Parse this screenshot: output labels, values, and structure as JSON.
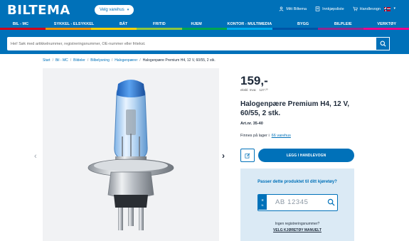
{
  "header": {
    "logo": "BILTEMA",
    "store_button": "Velg varehus",
    "links": [
      {
        "label": "Mitt Biltema",
        "icon": "user-icon"
      },
      {
        "label": "Innkjøpsliste",
        "icon": "list-icon"
      },
      {
        "label": "Handlevogn",
        "icon": "cart-icon"
      }
    ],
    "flag_icon": "norway-flag-icon"
  },
  "nav": {
    "items": [
      {
        "label": "BIL - MC",
        "color": "#d0021b"
      },
      {
        "label": "SYKKEL - ELSYKKEL",
        "color": "#f39200"
      },
      {
        "label": "BÅT",
        "color": "#ffd200"
      },
      {
        "label": "FRITID",
        "color": "#8cc63f"
      },
      {
        "label": "HJEM",
        "color": "#00a651"
      },
      {
        "label": "KONTOR - MULTIMEDIA",
        "color": "#00aeef"
      },
      {
        "label": "BYGG",
        "color": "#0054a6"
      },
      {
        "label": "BILPLEIE",
        "color": "#92278f"
      },
      {
        "label": "VERKTØY",
        "color": "#ec008c"
      }
    ]
  },
  "search": {
    "placeholder": "Hei! Søk med artikkelnummer, registreringsnummer, OE-nummer eller fritekst."
  },
  "breadcrumb": {
    "items": [
      "Start",
      "Bil - MC",
      "Bildeler",
      "Bilbelysning",
      "Halogenpærer"
    ],
    "current": "Halogenpære Premium H4, 12 V, 60/55, 2 stk."
  },
  "product": {
    "price": "159,-",
    "price_ex_label": "ekskl. mva:",
    "price_ex_value": "127.²⁰",
    "title": "Halogenpære Premium H4, 12 V, 60/55, 2 stk.",
    "art_nr": "Art.nr. 35-40",
    "stock_text": "Finnes på lager i",
    "stock_link": "66 varehus",
    "add_to_cart": "LEGG I HANDLEVOGN"
  },
  "fit_check": {
    "question": "Passer dette produktet til ditt kjøretøy?",
    "plate_country": "N",
    "plate_placeholder": "AB 12345",
    "no_reg": "Ingen registreringsnummer?",
    "manual_link": "VELG KJØRETØY MANUELT"
  },
  "colors": {
    "brand_blue": "#0071b9",
    "fit_box_bg": "#dbeaf5",
    "gallery_bg": "#f1f2f4"
  }
}
